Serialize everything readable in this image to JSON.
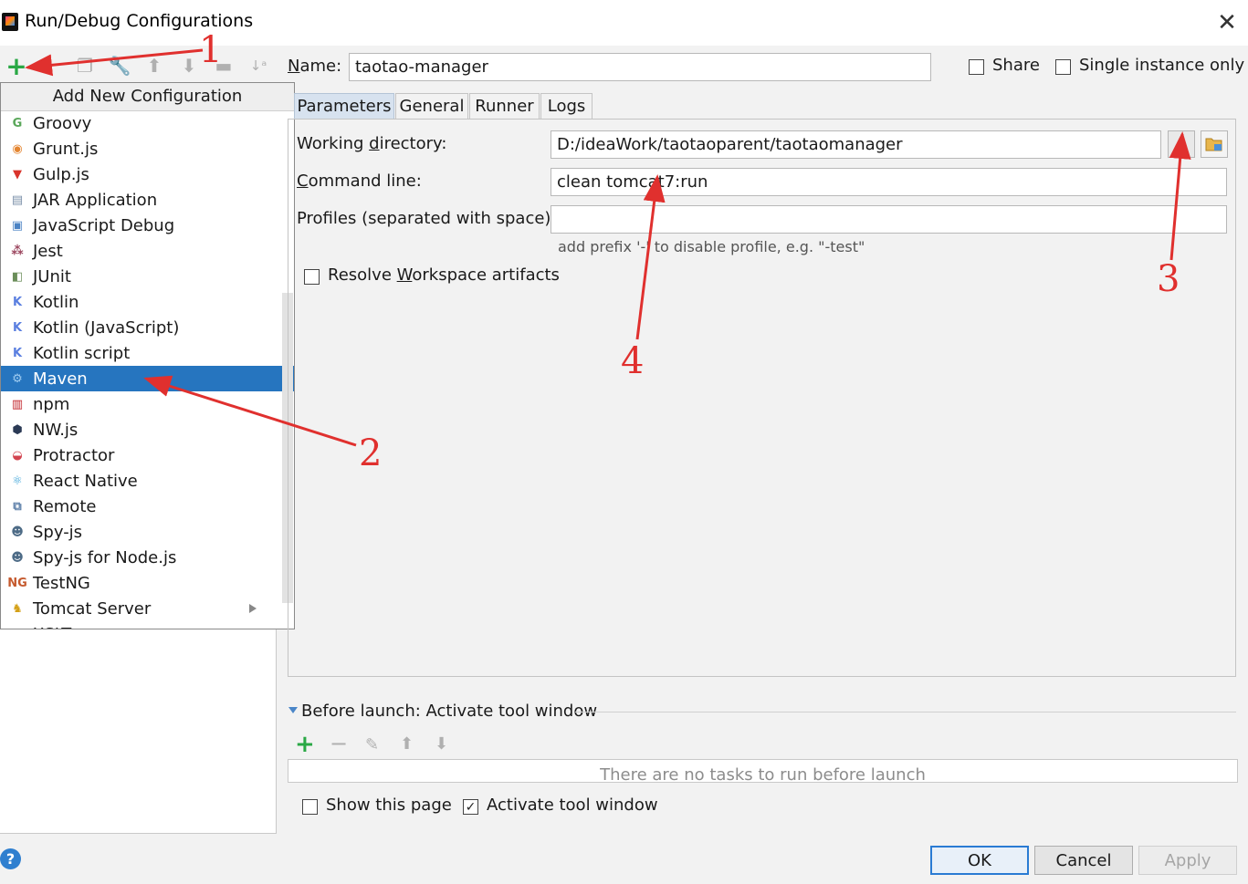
{
  "window": {
    "title": "Run/Debug Configurations",
    "close_glyph": "✕"
  },
  "popup": {
    "header": "Add New Configuration",
    "items": [
      {
        "label": "Groovy",
        "icon": "groovy-icon",
        "glyph": "G",
        "color": "#5aa75a"
      },
      {
        "label": "Grunt.js",
        "icon": "grunt-icon",
        "glyph": "◉",
        "color": "#e48632"
      },
      {
        "label": "Gulp.js",
        "icon": "gulp-icon",
        "glyph": "▼",
        "color": "#d9342b"
      },
      {
        "label": "JAR Application",
        "icon": "jar-icon",
        "glyph": "▤",
        "color": "#7a8fa8"
      },
      {
        "label": "JavaScript Debug",
        "icon": "javascript-debug-icon",
        "glyph": "▣",
        "color": "#4b83c4"
      },
      {
        "label": "Jest",
        "icon": "jest-icon",
        "glyph": "⁂",
        "color": "#99425b"
      },
      {
        "label": "JUnit",
        "icon": "junit-icon",
        "glyph": "◧",
        "color": "#6b8e5a"
      },
      {
        "label": "Kotlin",
        "icon": "kotlin-icon",
        "glyph": "K",
        "color": "#5a7fe0"
      },
      {
        "label": "Kotlin (JavaScript)",
        "icon": "kotlin-javascript-icon",
        "glyph": "K",
        "color": "#5a7fe0"
      },
      {
        "label": "Kotlin script",
        "icon": "kotlin-script-icon",
        "glyph": "K",
        "color": "#5a7fe0"
      },
      {
        "label": "Maven",
        "icon": "maven-gear-icon",
        "glyph": "⚙",
        "color": "#9ecbf0"
      },
      {
        "label": "npm",
        "icon": "npm-icon",
        "glyph": "▥",
        "color": "#c12127"
      },
      {
        "label": "NW.js",
        "icon": "nwjs-icon",
        "glyph": "⬢",
        "color": "#2b3a55"
      },
      {
        "label": "Protractor",
        "icon": "protractor-icon",
        "glyph": "◒",
        "color": "#d2434f"
      },
      {
        "label": "React Native",
        "icon": "react-native-icon",
        "glyph": "⚛",
        "color": "#3aa3d8"
      },
      {
        "label": "Remote",
        "icon": "remote-icon",
        "glyph": "⧉",
        "color": "#5b7ea8"
      },
      {
        "label": "Spy-js",
        "icon": "spy-js-icon",
        "glyph": "☻",
        "color": "#4d6b86"
      },
      {
        "label": "Spy-js for Node.js",
        "icon": "spy-js-node-icon",
        "glyph": "☻",
        "color": "#4d6b86"
      },
      {
        "label": "TestNG",
        "icon": "testng-icon",
        "glyph": "NG",
        "color": "#c55a2e"
      },
      {
        "label": "Tomcat Server",
        "icon": "tomcat-icon",
        "glyph": "♞",
        "color": "#d4a017"
      },
      {
        "label": "XSLT",
        "icon": "xslt-icon",
        "glyph": "XS",
        "color": "#d12b2b"
      }
    ],
    "selected_index": 10
  },
  "form": {
    "name_label": "Name:",
    "name_value": "taotao-manager",
    "share_label": "Share",
    "single_instance_label": "Single instance only",
    "tabs": [
      "Parameters",
      "General",
      "Runner",
      "Logs"
    ],
    "active_tab": "Parameters",
    "working_dir_label": "Working directory:",
    "working_dir_value": "D:/ideaWork/taotaoparent/taotaomanager",
    "browse_label": "...",
    "command_line_label": "Command line:",
    "command_line_value": "clean tomcat7:run",
    "profiles_label": "Profiles (separated with space):",
    "profiles_value": "",
    "profiles_hint": "add prefix '-' to disable profile, e.g. \"-test\"",
    "resolve_label": "Resolve Workspace artifacts"
  },
  "before_launch": {
    "title": "Before launch: Activate tool window",
    "empty_text": "There are no tasks to run before launch",
    "show_page_label": "Show this page",
    "activate_label": "Activate tool window",
    "activate_checked": true,
    "show_page_checked": false
  },
  "buttons": {
    "ok": "OK",
    "cancel": "Cancel",
    "apply": "Apply"
  },
  "annotations": [
    "1",
    "2",
    "3",
    "4"
  ],
  "colors": {
    "accent": "#2675bf",
    "annotation": "#e0302e",
    "add_green": "#2aa845"
  }
}
